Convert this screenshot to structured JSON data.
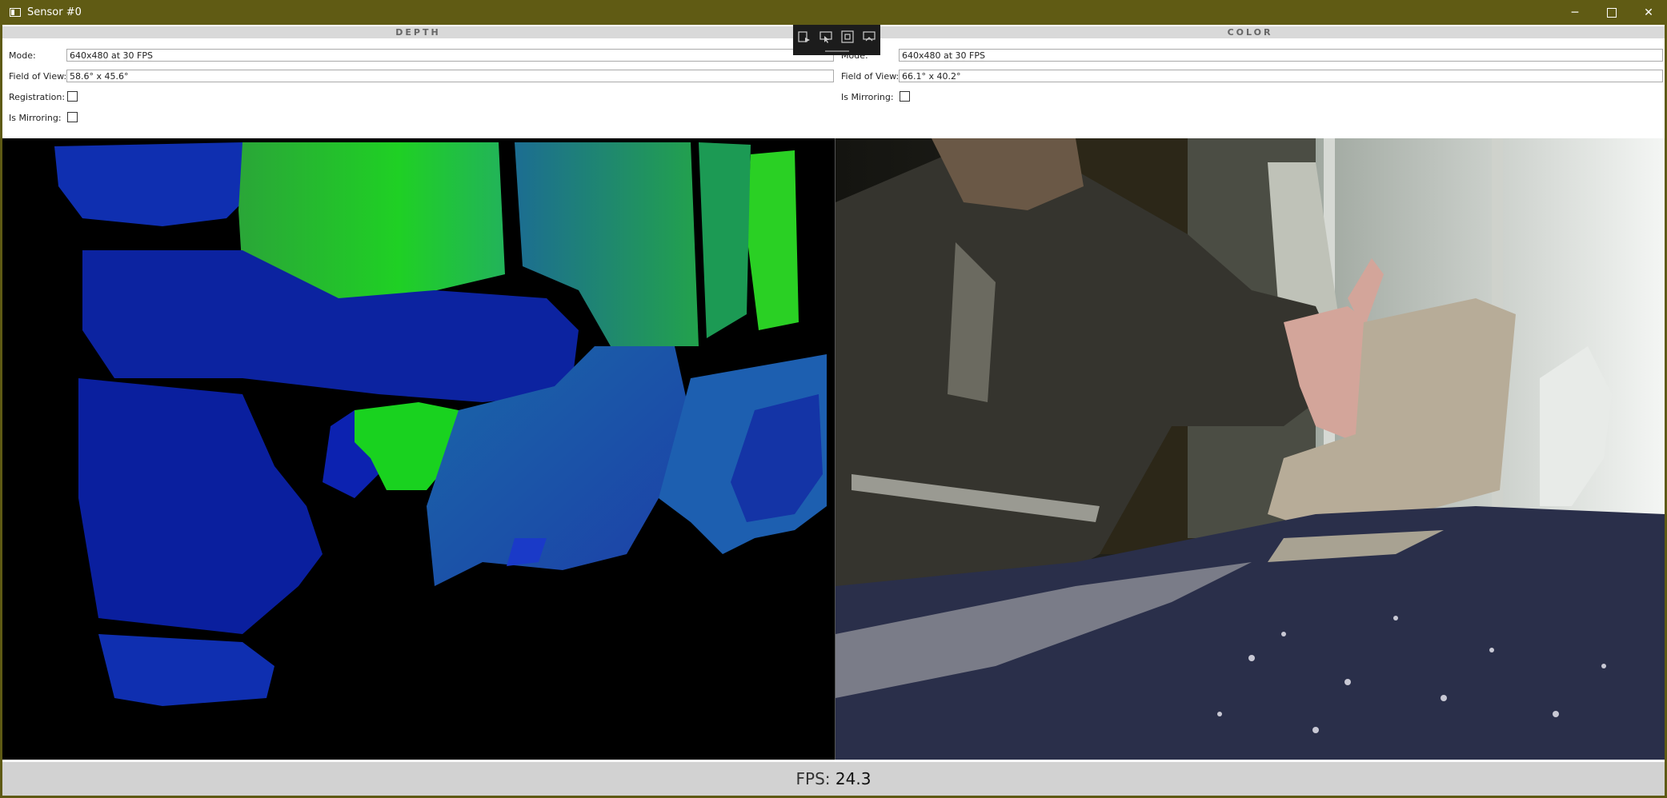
{
  "window": {
    "title": "Sensor #0",
    "minimize_glyph": "─",
    "close_glyph": "✕"
  },
  "toolbar": {
    "icons": [
      "record-icon",
      "snapshot-icon",
      "fit-icon",
      "settings-icon"
    ]
  },
  "depth": {
    "header": "DEPTH",
    "mode_label": "Mode:",
    "mode_value": "640x480 at 30 FPS",
    "fov_label": "Field of View:",
    "fov_value": "58.6° x 45.6°",
    "registration_label": "Registration:",
    "registration_checked": false,
    "mirroring_label": "Is Mirroring:",
    "mirroring_checked": false
  },
  "color": {
    "header": "COLOR",
    "mode_label": "Mode:",
    "mode_value": "640x480 at 30 FPS",
    "fov_label": "Field of View:",
    "fov_value": "66.1° x 40.2°",
    "mirroring_label": "Is Mirroring:",
    "mirroring_checked": false
  },
  "status": {
    "fps_label": "FPS:",
    "fps_value": "24.3"
  },
  "colors": {
    "titlebar": "#605b14",
    "depth_near": "#0a1aa0",
    "depth_mid": "#1e6ea0",
    "depth_far": "#22d22a"
  }
}
